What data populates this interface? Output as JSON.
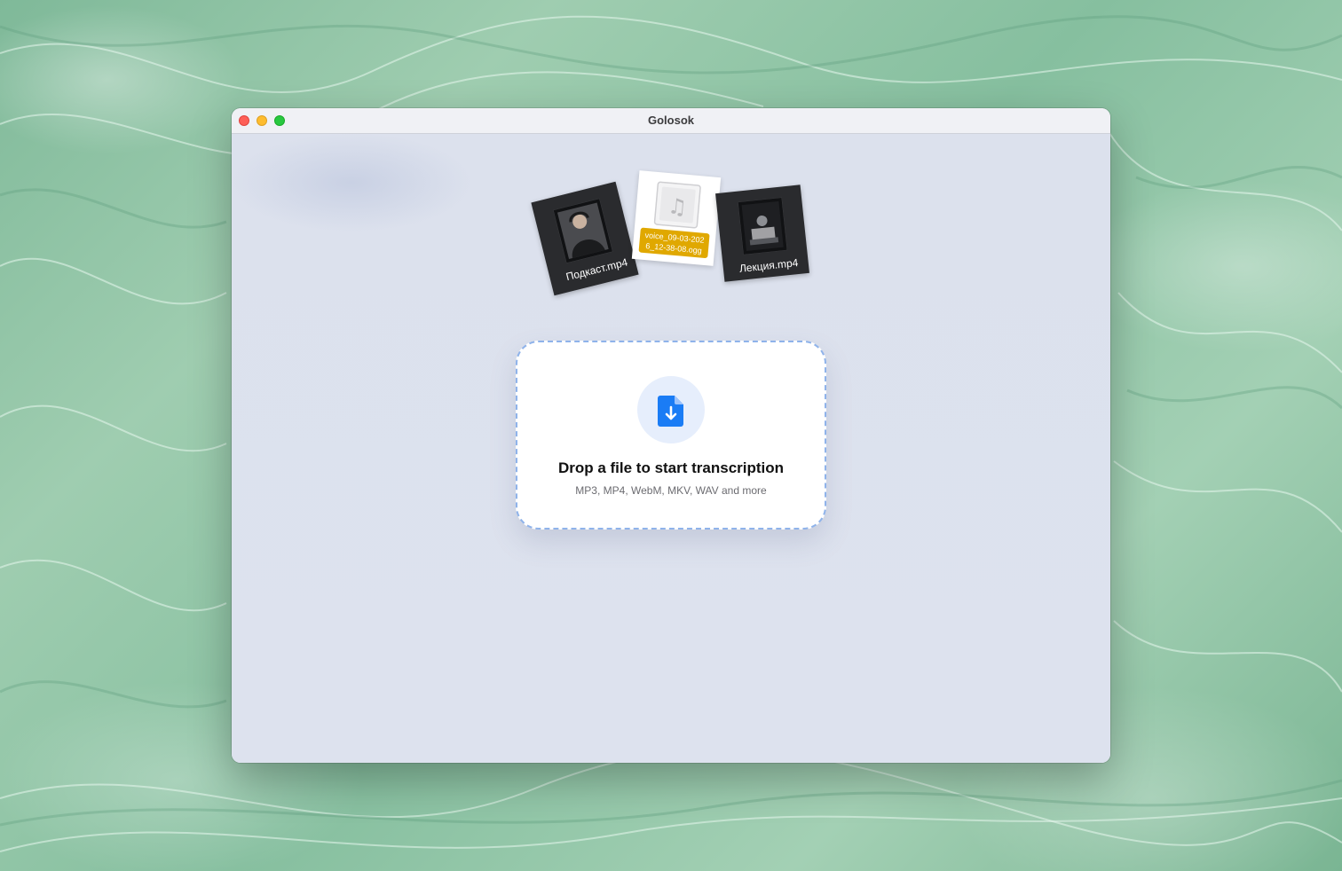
{
  "window": {
    "title": "Golosok"
  },
  "dragged_files": [
    {
      "name": "Подкаст.mp4",
      "kind": "video"
    },
    {
      "name": "voice_09-03-2026_12-38-08.ogg",
      "label_line1": "voice_09-03-202",
      "label_line2": "6_12-38-08.ogg",
      "kind": "audio"
    },
    {
      "name": "Лекция.mp4",
      "kind": "video"
    }
  ],
  "drop_zone": {
    "title": "Drop a file to start transcription",
    "subtitle": "MP3, MP4, WebM, MKV, WAV and more",
    "icon": "document-download-icon"
  },
  "colors": {
    "accent": "#1a7cf5",
    "drop_border": "#8fb3ea",
    "file_label_highlight": "#e0a800"
  }
}
